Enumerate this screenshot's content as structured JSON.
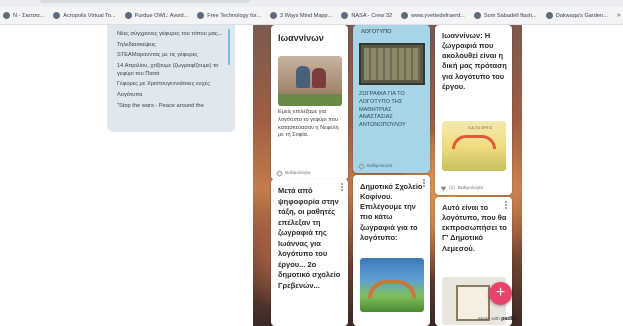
{
  "bookmarks": [
    {
      "label": "N - Σκετσα..."
    },
    {
      "label": "Acropolis Virtual To..."
    },
    {
      "label": "Purdue OWL: Avoid..."
    },
    {
      "label": "Free Technology for..."
    },
    {
      "label": "3 Ways Mind Mapp..."
    },
    {
      "label": "NASA - Crew 32"
    },
    {
      "label": "www.yvettedefraerd..."
    },
    {
      "label": "Som Sabadell flash..."
    },
    {
      "label": "Dakwaqa's Garden..."
    }
  ],
  "bookmarks_more": "»",
  "sidepanel": {
    "items": [
      "Νέες σύγχρονες γέφυρες του τόπου μας...",
      "Τηλεδιασκέψεις",
      "STEAMαρουντας με τις γέφυρες",
      "14 Απριλίου, χτίζουμε (ζωγραφίζουμε) το γεφύρι του Πασά",
      "Γέφυρες με Χριστουγεννιάτικες ευχές",
      "Λογότυπα",
      "\"Stop the wars - Peace around the"
    ]
  },
  "cards": {
    "c1a": {
      "heading": "Ιωαννίνων",
      "body": "Εμείς επιλέξαμε για λογότυπο το γεφύρι που κατασκεύασαν η Νεφέλη με τη Σοφία.",
      "author": "Βαθμολογία"
    },
    "c1b": {
      "heading": "Μετά από ψηφοφορία στην τάξη, οι μαθητές επέλεξαν τη ζωγραφιά της Ιωάννας για λογότυπο του έργου... 2ο δημοτικό σχολείο Γρεβενών..."
    },
    "c2a": {
      "toptext": "ΛΟΓΟΤΥΠΟ",
      "body": "ΖΩΓΡΑΦΙΑ ΓΙΑ ΤΟ ΛΟΓΟΤΥΠΟ ΤΗΣ ΜΑΘΗΤΡΙΑΣ ΑΝΑΣΤΑΣΙΑΣ ΑΝΤΩΝΟΠΟΥΛΟΥ",
      "author": "Βαθμολογία"
    },
    "c2b": {
      "heading": "Δημοτικό Σχολείο Κοφίνου. Επιλέγουμε την πιο κάτω ζωγραφιά για το λογότυπο:"
    },
    "c3a": {
      "heading": "Ιωαννίνων: Η ζωγραφιά που ακολουθεί είναι η δική μας πρόταση για λογότυπο του έργου.",
      "pic_label": "ΓΙΑ ΤΟ ΕΡΓΟ",
      "author": "Βαθμολογία",
      "likes": "(1)"
    },
    "c3b": {
      "heading": "Αυτό είναι το λογότυπο, που θα εκπροσωπήσει το Γ' Δημοτικό Λεμεσού."
    }
  },
  "fab_label": "+",
  "madewith": {
    "prefix": "Made with",
    "brand": "padlet"
  },
  "colors": {
    "fab": "#e8446a",
    "highlight_card": "#a7d5e8",
    "sidepanel": "#dfe8ef"
  }
}
